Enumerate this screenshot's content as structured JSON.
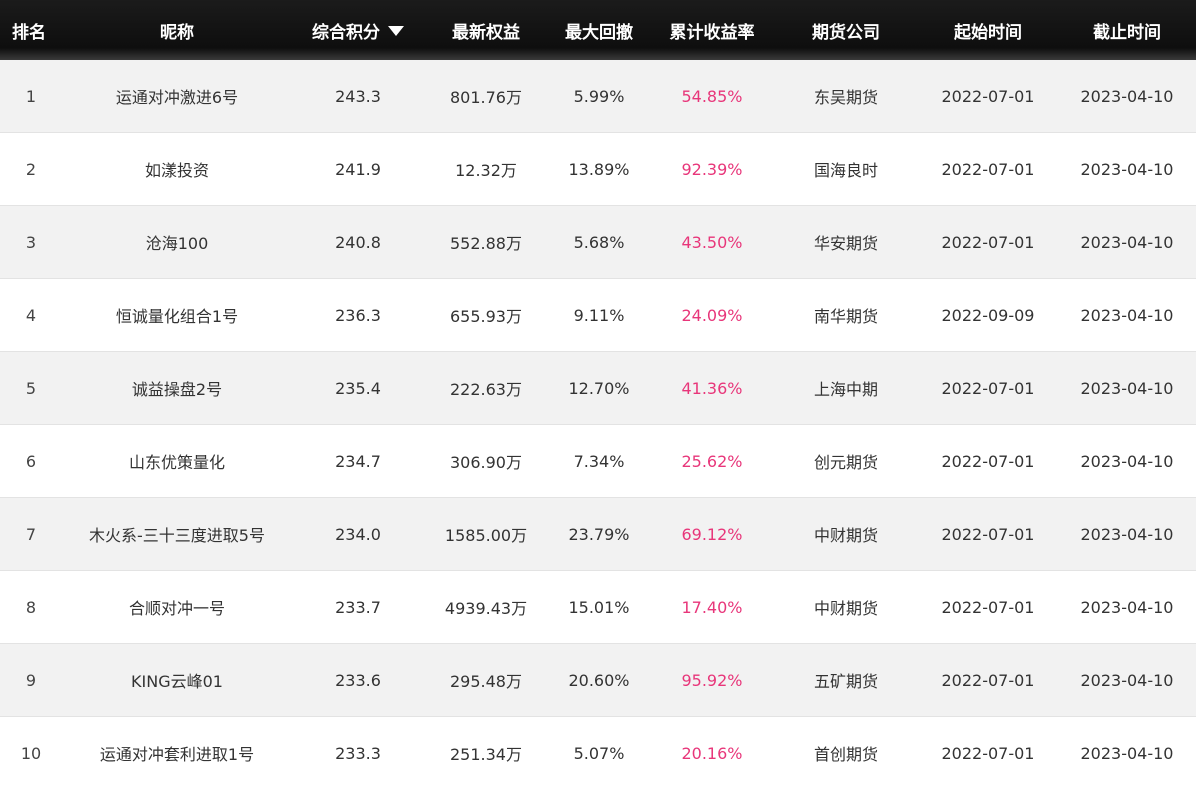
{
  "header": {
    "rank": "排名",
    "nickname": "昵称",
    "score": "综合积分",
    "equity": "最新权益",
    "drawdown": "最大回撤",
    "return": "累计收益率",
    "company": "期货公司",
    "start": "起始时间",
    "end": "截止时间"
  },
  "colors": {
    "header_bg": "#0e0e0e",
    "row_alt": "#f2f2f2",
    "return_text": "#e8367a"
  },
  "rows": [
    {
      "rank": "1",
      "nickname": "运通对冲激进6号",
      "score": "243.3",
      "equity": "801.76万",
      "drawdown": "5.99%",
      "return": "54.85%",
      "company": "东吴期货",
      "start": "2022-07-01",
      "end": "2023-04-10"
    },
    {
      "rank": "2",
      "nickname": "如漾投资",
      "score": "241.9",
      "equity": "12.32万",
      "drawdown": "13.89%",
      "return": "92.39%",
      "company": "国海良时",
      "start": "2022-07-01",
      "end": "2023-04-10"
    },
    {
      "rank": "3",
      "nickname": "沧海100",
      "score": "240.8",
      "equity": "552.88万",
      "drawdown": "5.68%",
      "return": "43.50%",
      "company": "华安期货",
      "start": "2022-07-01",
      "end": "2023-04-10"
    },
    {
      "rank": "4",
      "nickname": "恒诚量化组合1号",
      "score": "236.3",
      "equity": "655.93万",
      "drawdown": "9.11%",
      "return": "24.09%",
      "company": "南华期货",
      "start": "2022-09-09",
      "end": "2023-04-10"
    },
    {
      "rank": "5",
      "nickname": "诚益操盘2号",
      "score": "235.4",
      "equity": "222.63万",
      "drawdown": "12.70%",
      "return": "41.36%",
      "company": "上海中期",
      "start": "2022-07-01",
      "end": "2023-04-10"
    },
    {
      "rank": "6",
      "nickname": "山东优策量化",
      "score": "234.7",
      "equity": "306.90万",
      "drawdown": "7.34%",
      "return": "25.62%",
      "company": "创元期货",
      "start": "2022-07-01",
      "end": "2023-04-10"
    },
    {
      "rank": "7",
      "nickname": "木火系-三十三度进取5号",
      "score": "234.0",
      "equity": "1585.00万",
      "drawdown": "23.79%",
      "return": "69.12%",
      "company": "中财期货",
      "start": "2022-07-01",
      "end": "2023-04-10"
    },
    {
      "rank": "8",
      "nickname": "合顺对冲一号",
      "score": "233.7",
      "equity": "4939.43万",
      "drawdown": "15.01%",
      "return": "17.40%",
      "company": "中财期货",
      "start": "2022-07-01",
      "end": "2023-04-10"
    },
    {
      "rank": "9",
      "nickname": "KING云峰01",
      "score": "233.6",
      "equity": "295.48万",
      "drawdown": "20.60%",
      "return": "95.92%",
      "company": "五矿期货",
      "start": "2022-07-01",
      "end": "2023-04-10"
    },
    {
      "rank": "10",
      "nickname": "运通对冲套利进取1号",
      "score": "233.3",
      "equity": "251.34万",
      "drawdown": "5.07%",
      "return": "20.16%",
      "company": "首创期货",
      "start": "2022-07-01",
      "end": "2023-04-10"
    }
  ]
}
